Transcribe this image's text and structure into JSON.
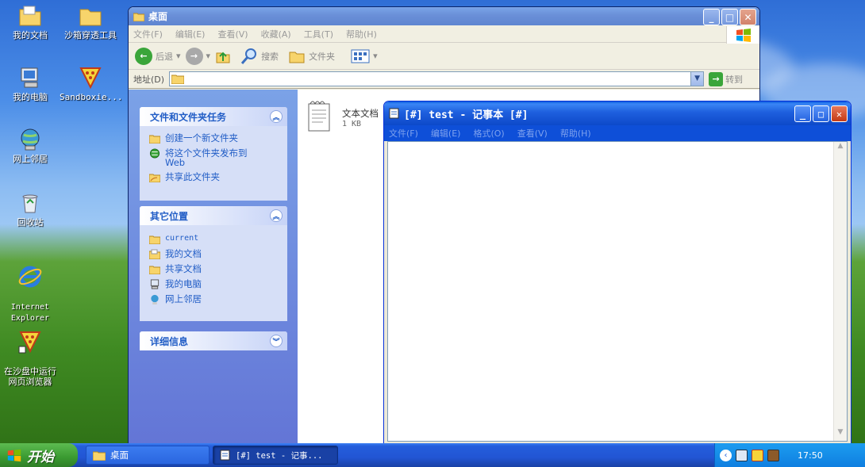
{
  "desktop": {
    "icons": [
      {
        "label": "我的文档"
      },
      {
        "label": "沙箱穿透工具"
      },
      {
        "label": "我的电脑"
      },
      {
        "label": "Sandboxie..."
      },
      {
        "label": "网上邻居"
      },
      {
        "label": "回收站"
      },
      {
        "label": "Internet\nExplorer"
      },
      {
        "label": "在沙盘中运行\n网页浏览器"
      }
    ]
  },
  "explorer": {
    "title": "桌面",
    "menu": [
      "文件(F)",
      "编辑(E)",
      "查看(V)",
      "收藏(A)",
      "工具(T)",
      "帮助(H)"
    ],
    "toolbar": {
      "back": "后退",
      "search": "搜索",
      "folders": "文件夹"
    },
    "address": {
      "label": "地址(D)",
      "value": "",
      "go": "转到"
    },
    "tasks_panel": {
      "title": "文件和文件夹任务",
      "items": [
        "创建一个新文件夹",
        "将这个文件夹发布到\nWeb",
        "共享此文件夹"
      ]
    },
    "places_panel": {
      "title": "其它位置",
      "items": [
        "current",
        "我的文档",
        "共享文档",
        "我的电脑",
        "网上邻居"
      ]
    },
    "details_panel": {
      "title": "详细信息"
    },
    "file": {
      "type": "文本文档",
      "size": "1 KB"
    }
  },
  "notepad": {
    "title": "[#] test - 记事本 [#]",
    "menu": [
      "文件(F)",
      "编辑(E)",
      "格式(O)",
      "查看(V)",
      "帮助(H)"
    ],
    "content": ""
  },
  "taskbar": {
    "start": "开始",
    "tasks": [
      {
        "label": "桌面"
      },
      {
        "label": "[#] test - 记事..."
      }
    ],
    "clock": "17:50"
  },
  "colors": {
    "accent": "#0a5ce0",
    "task_active": "#1941a5",
    "link": "#215dc6"
  }
}
